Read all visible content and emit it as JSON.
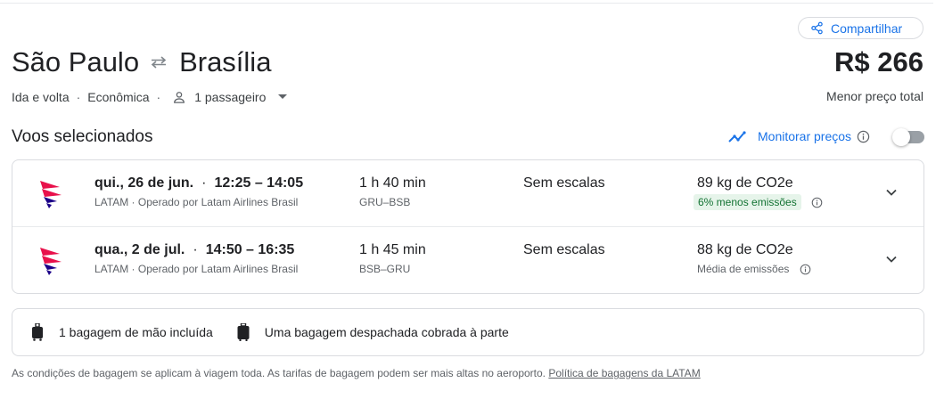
{
  "share": {
    "label": "Compartilhar",
    "icon": "share-icon"
  },
  "trip": {
    "origin": "São Paulo",
    "destination": "Brasília",
    "type": "Ida e volta",
    "cabin": "Econômica",
    "passengers": "1 passageiro"
  },
  "price": {
    "total": "R$ 266",
    "caption": "Menor preço total"
  },
  "selected": {
    "title": "Voos selecionados",
    "monitor_label": "Monitorar preços",
    "monitor_on": false
  },
  "flights": [
    {
      "date": "qui., 26 de jun.",
      "times": "12:25 – 14:05",
      "carrier": "LATAM · Operado por Latam Airlines Brasil",
      "duration": "1 h 40 min",
      "route": "GRU–BSB",
      "stops": "Sem escalas",
      "co2": "89 kg de CO2e",
      "emissions": "6% menos emissões",
      "emissions_status": "lower"
    },
    {
      "date": "qua., 2 de jul.",
      "times": "14:50 – 16:35",
      "carrier": "LATAM · Operado por Latam Airlines Brasil",
      "duration": "1 h 45 min",
      "route": "BSB–GRU",
      "stops": "Sem escalas",
      "co2": "88 kg de CO2e",
      "emissions": "Média de emissões",
      "emissions_status": "average"
    }
  ],
  "baggage": {
    "carry_on": "1 bagagem de mão incluída",
    "checked": "Uma bagagem despachada cobrada à parte"
  },
  "footnote": {
    "text": "As condições de bagagem se aplicam à viagem toda. As tarifas de bagagem podem ser mais altas no aeroporto.",
    "link": "Política de bagagens da LATAM"
  },
  "colors": {
    "accent": "#1a73e8",
    "green_badge_bg": "#e6f4ea",
    "green_badge_text": "#137333",
    "latam_magenta": "#e8114b",
    "latam_indigo": "#1b0088"
  }
}
